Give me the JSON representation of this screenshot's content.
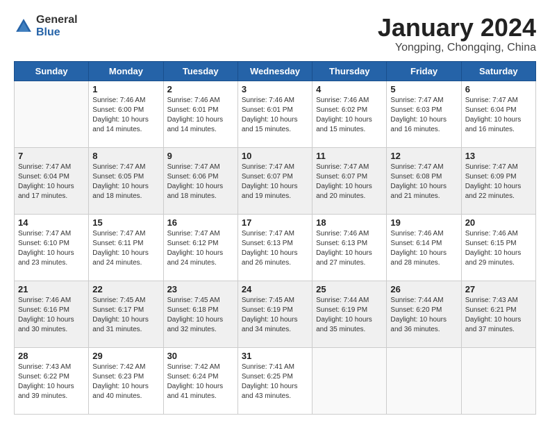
{
  "logo": {
    "general": "General",
    "blue": "Blue"
  },
  "title": "January 2024",
  "location": "Yongping, Chongqing, China",
  "weekdays": [
    "Sunday",
    "Monday",
    "Tuesday",
    "Wednesday",
    "Thursday",
    "Friday",
    "Saturday"
  ],
  "weeks": [
    [
      {
        "day": "",
        "info": ""
      },
      {
        "day": "1",
        "info": "Sunrise: 7:46 AM\nSunset: 6:00 PM\nDaylight: 10 hours\nand 14 minutes."
      },
      {
        "day": "2",
        "info": "Sunrise: 7:46 AM\nSunset: 6:01 PM\nDaylight: 10 hours\nand 14 minutes."
      },
      {
        "day": "3",
        "info": "Sunrise: 7:46 AM\nSunset: 6:01 PM\nDaylight: 10 hours\nand 15 minutes."
      },
      {
        "day": "4",
        "info": "Sunrise: 7:46 AM\nSunset: 6:02 PM\nDaylight: 10 hours\nand 15 minutes."
      },
      {
        "day": "5",
        "info": "Sunrise: 7:47 AM\nSunset: 6:03 PM\nDaylight: 10 hours\nand 16 minutes."
      },
      {
        "day": "6",
        "info": "Sunrise: 7:47 AM\nSunset: 6:04 PM\nDaylight: 10 hours\nand 16 minutes."
      }
    ],
    [
      {
        "day": "7",
        "info": "Sunrise: 7:47 AM\nSunset: 6:04 PM\nDaylight: 10 hours\nand 17 minutes."
      },
      {
        "day": "8",
        "info": "Sunrise: 7:47 AM\nSunset: 6:05 PM\nDaylight: 10 hours\nand 18 minutes."
      },
      {
        "day": "9",
        "info": "Sunrise: 7:47 AM\nSunset: 6:06 PM\nDaylight: 10 hours\nand 18 minutes."
      },
      {
        "day": "10",
        "info": "Sunrise: 7:47 AM\nSunset: 6:07 PM\nDaylight: 10 hours\nand 19 minutes."
      },
      {
        "day": "11",
        "info": "Sunrise: 7:47 AM\nSunset: 6:07 PM\nDaylight: 10 hours\nand 20 minutes."
      },
      {
        "day": "12",
        "info": "Sunrise: 7:47 AM\nSunset: 6:08 PM\nDaylight: 10 hours\nand 21 minutes."
      },
      {
        "day": "13",
        "info": "Sunrise: 7:47 AM\nSunset: 6:09 PM\nDaylight: 10 hours\nand 22 minutes."
      }
    ],
    [
      {
        "day": "14",
        "info": "Sunrise: 7:47 AM\nSunset: 6:10 PM\nDaylight: 10 hours\nand 23 minutes."
      },
      {
        "day": "15",
        "info": "Sunrise: 7:47 AM\nSunset: 6:11 PM\nDaylight: 10 hours\nand 24 minutes."
      },
      {
        "day": "16",
        "info": "Sunrise: 7:47 AM\nSunset: 6:12 PM\nDaylight: 10 hours\nand 24 minutes."
      },
      {
        "day": "17",
        "info": "Sunrise: 7:47 AM\nSunset: 6:13 PM\nDaylight: 10 hours\nand 26 minutes."
      },
      {
        "day": "18",
        "info": "Sunrise: 7:46 AM\nSunset: 6:13 PM\nDaylight: 10 hours\nand 27 minutes."
      },
      {
        "day": "19",
        "info": "Sunrise: 7:46 AM\nSunset: 6:14 PM\nDaylight: 10 hours\nand 28 minutes."
      },
      {
        "day": "20",
        "info": "Sunrise: 7:46 AM\nSunset: 6:15 PM\nDaylight: 10 hours\nand 29 minutes."
      }
    ],
    [
      {
        "day": "21",
        "info": "Sunrise: 7:46 AM\nSunset: 6:16 PM\nDaylight: 10 hours\nand 30 minutes."
      },
      {
        "day": "22",
        "info": "Sunrise: 7:45 AM\nSunset: 6:17 PM\nDaylight: 10 hours\nand 31 minutes."
      },
      {
        "day": "23",
        "info": "Sunrise: 7:45 AM\nSunset: 6:18 PM\nDaylight: 10 hours\nand 32 minutes."
      },
      {
        "day": "24",
        "info": "Sunrise: 7:45 AM\nSunset: 6:19 PM\nDaylight: 10 hours\nand 34 minutes."
      },
      {
        "day": "25",
        "info": "Sunrise: 7:44 AM\nSunset: 6:19 PM\nDaylight: 10 hours\nand 35 minutes."
      },
      {
        "day": "26",
        "info": "Sunrise: 7:44 AM\nSunset: 6:20 PM\nDaylight: 10 hours\nand 36 minutes."
      },
      {
        "day": "27",
        "info": "Sunrise: 7:43 AM\nSunset: 6:21 PM\nDaylight: 10 hours\nand 37 minutes."
      }
    ],
    [
      {
        "day": "28",
        "info": "Sunrise: 7:43 AM\nSunset: 6:22 PM\nDaylight: 10 hours\nand 39 minutes."
      },
      {
        "day": "29",
        "info": "Sunrise: 7:42 AM\nSunset: 6:23 PM\nDaylight: 10 hours\nand 40 minutes."
      },
      {
        "day": "30",
        "info": "Sunrise: 7:42 AM\nSunset: 6:24 PM\nDaylight: 10 hours\nand 41 minutes."
      },
      {
        "day": "31",
        "info": "Sunrise: 7:41 AM\nSunset: 6:25 PM\nDaylight: 10 hours\nand 43 minutes."
      },
      {
        "day": "",
        "info": ""
      },
      {
        "day": "",
        "info": ""
      },
      {
        "day": "",
        "info": ""
      }
    ]
  ]
}
